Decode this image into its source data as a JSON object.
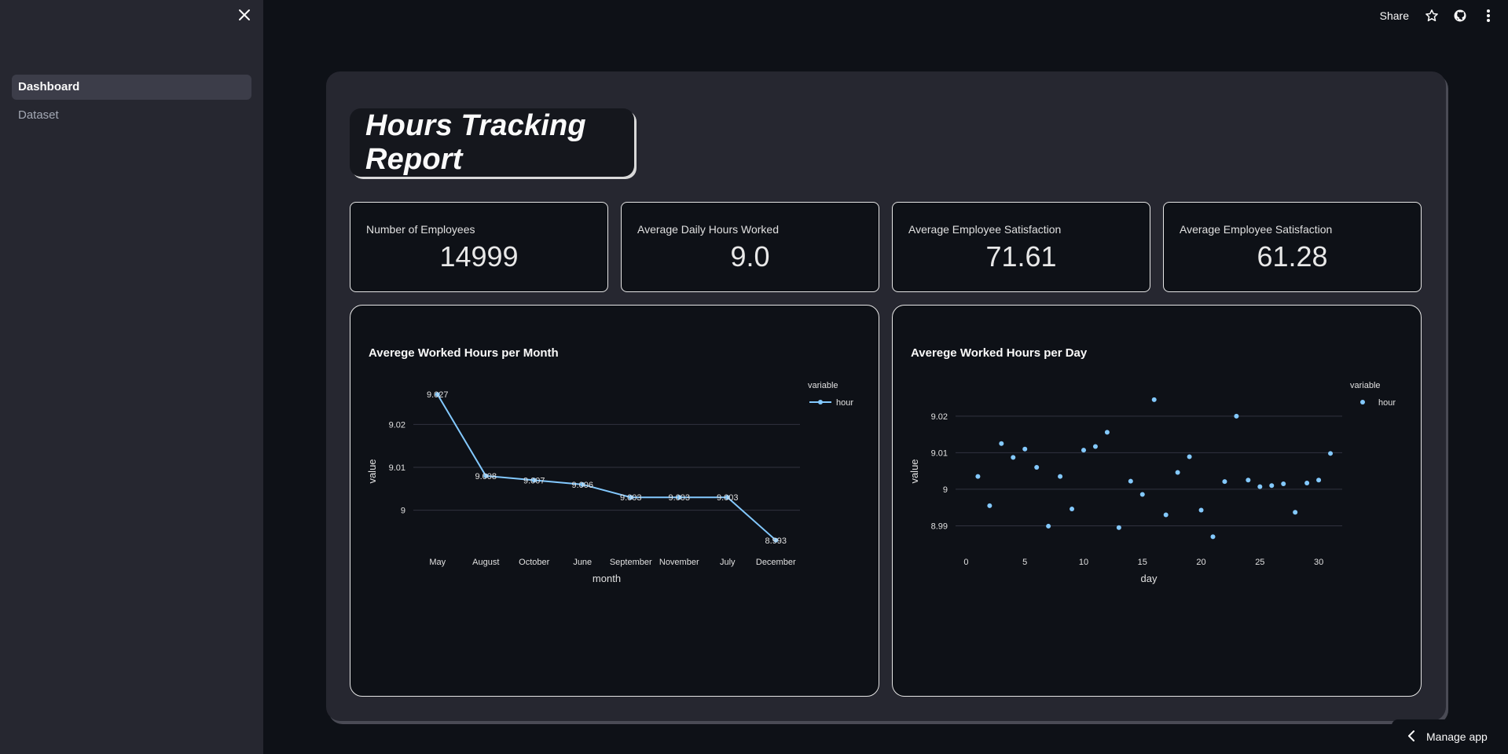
{
  "sidebar": {
    "close_icon": "close-icon",
    "items": [
      {
        "label": "Dashboard",
        "active": true
      },
      {
        "label": "Dataset",
        "active": false
      }
    ]
  },
  "header": {
    "share_label": "Share",
    "icons": [
      "star-icon",
      "github-icon",
      "more-vertical-icon"
    ]
  },
  "main": {
    "title": "Hours Tracking Report",
    "metrics": [
      {
        "label": "Number of Employees",
        "value": "14999"
      },
      {
        "label": "Average Daily Hours Worked",
        "value": "9.0"
      },
      {
        "label": "Average Employee Satisfaction",
        "value": "71.61"
      },
      {
        "label": "Average Employee Satisfaction",
        "value": "61.28"
      }
    ]
  },
  "chart_data": [
    {
      "type": "line",
      "title": "Averege Worked Hours per Month",
      "xlabel": "month",
      "ylabel": "value",
      "categories": [
        "May",
        "August",
        "October",
        "June",
        "September",
        "November",
        "July",
        "December"
      ],
      "series": [
        {
          "name": "hour",
          "values": [
            9.027,
            9.008,
            9.007,
            9.006,
            9.003,
            9.003,
            9.003,
            8.993
          ]
        }
      ],
      "data_labels": [
        "9.027",
        "9.008",
        "9.007",
        "9.006",
        "9.003",
        "9.003",
        "9.003",
        "8.993"
      ],
      "yticks": [
        9,
        9.01,
        9.02
      ],
      "ylim": [
        8.9915,
        9.0285
      ],
      "legend": {
        "title": "variable",
        "position": "top-right"
      },
      "grid": true,
      "color": "#83c9ff"
    },
    {
      "type": "scatter",
      "title": "Averege Worked Hours per Day",
      "xlabel": "day",
      "ylabel": "value",
      "x": [
        1,
        2,
        3,
        4,
        5,
        6,
        7,
        8,
        9,
        10,
        11,
        12,
        13,
        14,
        15,
        16,
        17,
        18,
        19,
        20,
        21,
        22,
        23,
        24,
        25,
        26,
        27,
        28,
        29,
        30,
        31
      ],
      "series": [
        {
          "name": "hour",
          "values": [
            9.0035,
            8.9955,
            9.0125,
            9.0087,
            9.011,
            9.006,
            8.9899,
            9.0035,
            8.9946,
            9.0107,
            9.0117,
            9.0156,
            8.9895,
            9.0022,
            8.9986,
            9.0245,
            8.993,
            9.0046,
            9.0089,
            8.9943,
            8.987,
            9.0021,
            9.02,
            9.0025,
            9.0007,
            9.001,
            9.0015,
            8.9937,
            9.0017,
            9.0025,
            9.0098
          ]
        }
      ],
      "xticks": [
        0,
        5,
        10,
        15,
        20,
        25,
        30
      ],
      "yticks": [
        8.99,
        9,
        9.01,
        9.02
      ],
      "xlim": [
        -0.9,
        32
      ],
      "ylim": [
        8.9843,
        9.0277
      ],
      "legend": {
        "title": "variable",
        "position": "top-right"
      },
      "grid": true,
      "color": "#83c9ff"
    }
  ],
  "footer": {
    "manage_label": "Manage app",
    "icon": "chevron-left-icon"
  }
}
